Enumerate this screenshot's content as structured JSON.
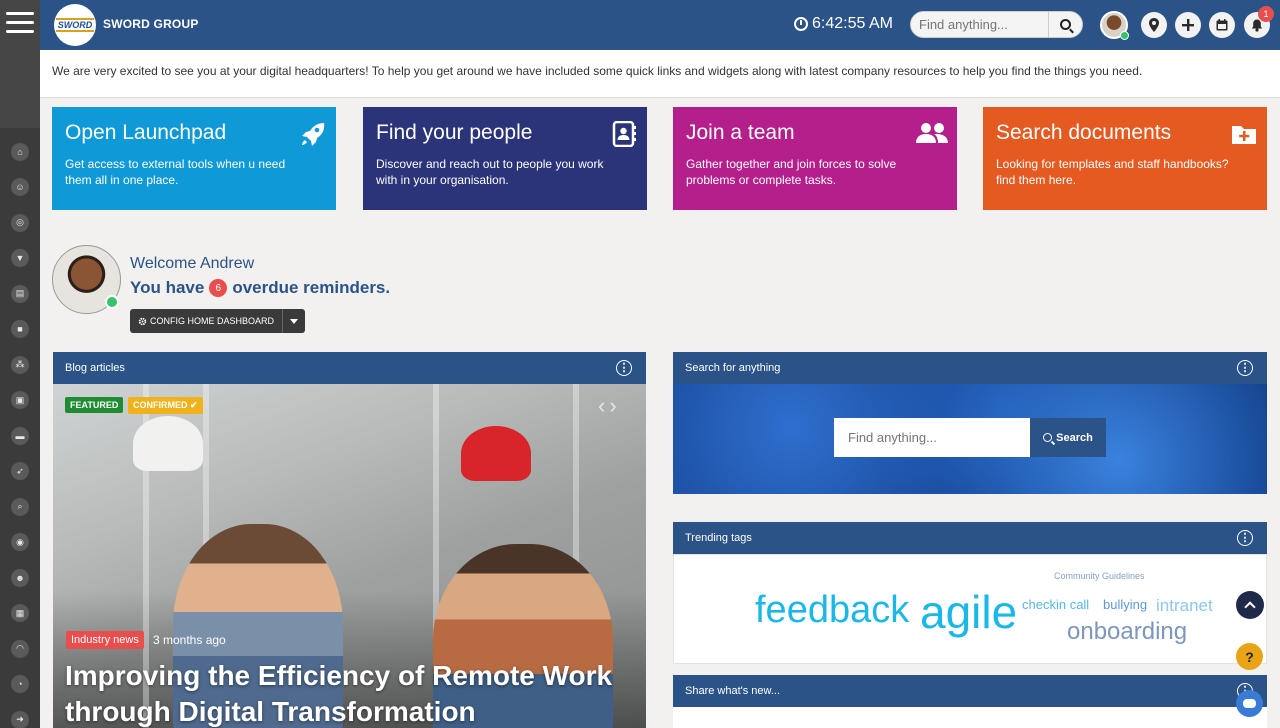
{
  "header": {
    "brand": "SWORD GROUP",
    "logo_text": "SWORD",
    "clock": "6:42:55 AM",
    "search_placeholder": "Find anything...",
    "notification_count": "1",
    "accent": "#2b5388"
  },
  "intro": {
    "text": "We are very excited to see you at your digital headquarters! To help you get around we have included some quick links and widgets along with latest company resources to help you find the things you need."
  },
  "tiles": [
    {
      "title": "Open Launchpad",
      "desc": "Get access to external tools when u need them all in one place.",
      "color": "#0f99d6",
      "icon": "rocket-icon"
    },
    {
      "title": "Find your people",
      "desc": "Discover and reach out to people you work with in your organisation.",
      "color": "#2b3478",
      "icon": "contact-book-icon"
    },
    {
      "title": "Join a team",
      "desc": "Gather together and join forces to solve problems or complete tasks.",
      "color": "#b51f8c",
      "icon": "users-icon"
    },
    {
      "title": "Search documents",
      "desc": "Looking for templates and staff handbooks? find them here.",
      "color": "#e55a21",
      "icon": "folder-plus-icon"
    }
  ],
  "welcome": {
    "greeting": "Welcome Andrew",
    "prefix": "You have",
    "count": "6",
    "suffix": "overdue reminders.",
    "config_button": "CONFIG HOME DASHBOARD"
  },
  "blog": {
    "panel_title": "Blog articles",
    "tag_featured": "FEATURED",
    "tag_confirmed": "CONFIRMED",
    "category": "Industry news",
    "time": "3 months ago",
    "title": "Improving the Efficiency of Remote Work through Digital Transformation"
  },
  "search_panel": {
    "title": "Search for anything",
    "placeholder": "Find anything...",
    "button": "Search"
  },
  "tags_panel": {
    "title": "Trending tags",
    "words": [
      "Community Guidelines",
      "feedback",
      "agile",
      "checkin call",
      "bullying",
      "intranet",
      "onboarding"
    ]
  },
  "share_panel": {
    "title": "Share what's new..."
  },
  "rail_icons": [
    "home-icon",
    "people-icon",
    "support-icon",
    "filter-icon",
    "news-icon",
    "page-icon",
    "org-chart-icon",
    "inbox-icon",
    "folder-icon",
    "rocket-icon",
    "search-icon",
    "chat-icon",
    "team-icon",
    "calendar-icon",
    "dashboard-icon",
    "timer-icon",
    "logout-icon"
  ]
}
